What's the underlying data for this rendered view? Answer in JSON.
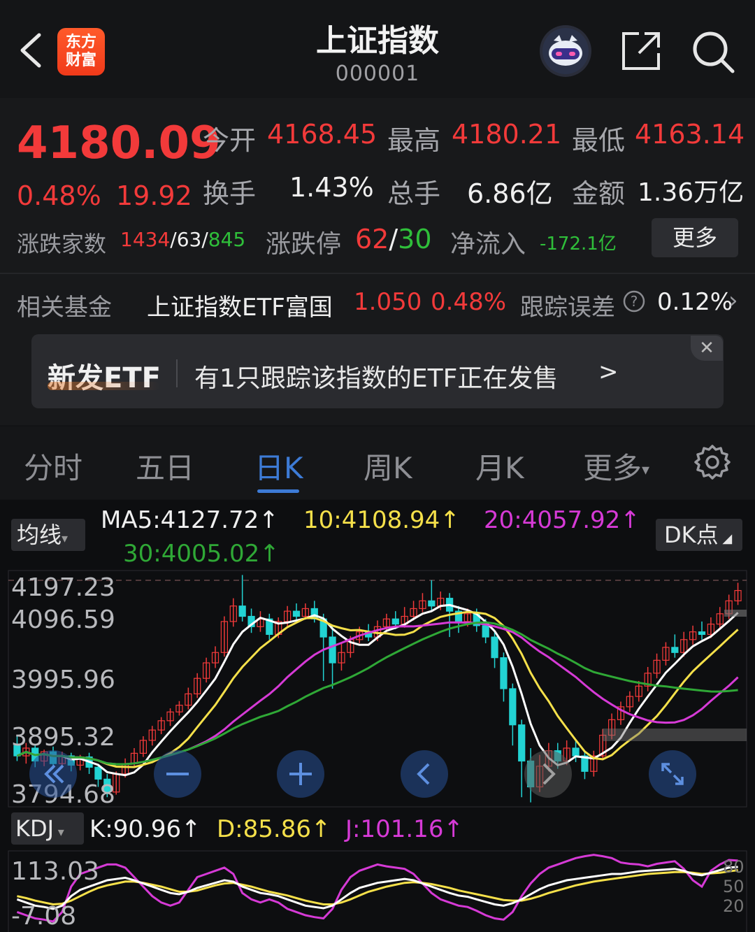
{
  "header": {
    "back_icon": "chevron-left-icon",
    "logo_line1": "东方",
    "logo_line2": "财富",
    "title": "上证指数",
    "code": "000001",
    "robot_icon": "robot-assistant-icon",
    "share_icon": "share-icon",
    "search_icon": "search-icon"
  },
  "quote": {
    "price": "4180.09",
    "change_pct": "0.48%",
    "change_val": "19.92",
    "open_label": "今开",
    "open": "4168.45",
    "high_label": "最高",
    "high": "4180.21",
    "low_label": "最低",
    "low": "4163.14",
    "turnover_label": "换手",
    "turnover": "1.43%",
    "volume_label": "总手",
    "volume": "6.86亿",
    "amount_label": "金额",
    "amount": "1.36万亿",
    "updown_label": "涨跌家数",
    "up_count": "1434",
    "sep1": "/",
    "flat_count": "63",
    "sep2": "/",
    "down_count": "845",
    "limit_label": "涨跌停",
    "limit_up": "62",
    "limit_sep": "/",
    "limit_down": "30",
    "inflow_label": "净流入",
    "inflow": "-172.1亿",
    "more_button": "更多"
  },
  "fund": {
    "label": "相关基金",
    "name": "上证指数ETF富国",
    "price": "1.050",
    "pct": "0.48%",
    "track_label": "跟踪误差",
    "help_icon": "question-circle-icon",
    "track_value": "0.12%",
    "chevron": "›"
  },
  "banner": {
    "tag": "新发ETF",
    "text": "有1只跟踪该指数的ETF正在发售",
    "arrow": ">",
    "close": "✕"
  },
  "tabs": [
    "分时",
    "五日",
    "日K",
    "周K",
    "月K",
    "更多"
  ],
  "active_tab": "日K",
  "settings_icon": "gear-icon",
  "ma": {
    "select": "均线",
    "ma5": "MA5:4127.72",
    "ma10": "10:4108.94",
    "ma20": "20:4057.92",
    "ma30": "30:4005.02",
    "arrow": "↑",
    "dk_button": "DK点",
    "colors": {
      "ma5": "#ffffff",
      "ma10": "#f5e04a",
      "ma20": "#d63ad6",
      "ma30": "#2fa836"
    }
  },
  "price_axis": [
    "4197.23",
    "4096.59",
    "3995.96",
    "3895.32",
    "3794.68"
  ],
  "kdj": {
    "select": "KDJ",
    "k": "K:90.96",
    "d": "D:85.86",
    "j": "J:101.16",
    "arrow": "↑",
    "axis_top": "113.03",
    "axis_bottom": "-7.08",
    "ref_80": "80",
    "ref_50": "50",
    "ref_20": "20"
  },
  "controls": [
    "rewind-icon",
    "zoom-out-icon",
    "zoom-in-icon",
    "prev-icon",
    "next-icon",
    "fullscreen-icon"
  ],
  "chart_data": {
    "type": "candlestick",
    "y_range": [
      3760,
      4220
    ],
    "candles": [
      [
        3880,
        3860,
        3900,
        3850
      ],
      [
        3860,
        3875,
        3885,
        3845
      ],
      [
        3875,
        3850,
        3880,
        3838
      ],
      [
        3850,
        3868,
        3872,
        3840
      ],
      [
        3868,
        3845,
        3878,
        3835
      ],
      [
        3845,
        3860,
        3868,
        3836
      ],
      [
        3860,
        3842,
        3866,
        3830
      ],
      [
        3842,
        3858,
        3862,
        3832
      ],
      [
        3858,
        3838,
        3866,
        3825
      ],
      [
        3838,
        3815,
        3842,
        3800
      ],
      [
        3815,
        3790,
        3825,
        3780
      ],
      [
        3790,
        3825,
        3830,
        3785
      ],
      [
        3825,
        3845,
        3855,
        3818
      ],
      [
        3845,
        3865,
        3875,
        3838
      ],
      [
        3865,
        3890,
        3898,
        3858
      ],
      [
        3890,
        3910,
        3918,
        3880
      ],
      [
        3910,
        3928,
        3935,
        3902
      ],
      [
        3928,
        3945,
        3952,
        3918
      ],
      [
        3945,
        3958,
        3966,
        3938
      ],
      [
        3958,
        3980,
        3992,
        3950
      ],
      [
        3980,
        4010,
        4020,
        3972
      ],
      [
        4010,
        4040,
        4050,
        4002
      ],
      [
        4040,
        4060,
        4072,
        4030
      ],
      [
        4060,
        4120,
        4130,
        4052
      ],
      [
        4120,
        4150,
        4165,
        4110
      ],
      [
        4150,
        4130,
        4210,
        4120
      ],
      [
        4130,
        4110,
        4145,
        4098
      ],
      [
        4110,
        4125,
        4140,
        4100
      ],
      [
        4125,
        4095,
        4135,
        4085
      ],
      [
        4095,
        4120,
        4128,
        4088
      ],
      [
        4120,
        4140,
        4150,
        4110
      ],
      [
        4140,
        4130,
        4155,
        4122
      ],
      [
        4130,
        4145,
        4155,
        4124
      ],
      [
        4145,
        4125,
        4160,
        4118
      ],
      [
        4125,
        4090,
        4135,
        4005
      ],
      [
        4090,
        4040,
        4110,
        3990
      ],
      [
        4040,
        4060,
        4080,
        4025
      ],
      [
        4060,
        4085,
        4092,
        4050
      ],
      [
        4085,
        4100,
        4110,
        4078
      ],
      [
        4100,
        4090,
        4115,
        4082
      ],
      [
        4090,
        4110,
        4122,
        4082
      ],
      [
        4110,
        4125,
        4135,
        4100
      ],
      [
        4125,
        4115,
        4140,
        4105
      ],
      [
        4115,
        4130,
        4148,
        4108
      ],
      [
        4130,
        4145,
        4160,
        4122
      ],
      [
        4145,
        4160,
        4175,
        4138
      ],
      [
        4160,
        4150,
        4200,
        4140
      ],
      [
        4150,
        4165,
        4178,
        4142
      ],
      [
        4165,
        4140,
        4175,
        4090
      ],
      [
        4140,
        4120,
        4150,
        4098
      ],
      [
        4120,
        4135,
        4145,
        4110
      ],
      [
        4135,
        4112,
        4145,
        4100
      ],
      [
        4112,
        4090,
        4125,
        4078
      ],
      [
        4090,
        4050,
        4100,
        4030
      ],
      [
        4050,
        3990,
        4060,
        3965
      ],
      [
        3990,
        3920,
        4000,
        3880
      ],
      [
        3920,
        3850,
        3930,
        3780
      ],
      [
        3850,
        3800,
        3875,
        3770
      ],
      [
        3800,
        3840,
        3862,
        3790
      ],
      [
        3840,
        3870,
        3885,
        3830
      ],
      [
        3870,
        3850,
        3885,
        3835
      ],
      [
        3850,
        3875,
        3890,
        3842
      ],
      [
        3875,
        3860,
        3890,
        3848
      ],
      [
        3860,
        3830,
        3870,
        3815
      ],
      [
        3830,
        3860,
        3870,
        3820
      ],
      [
        3860,
        3900,
        3912,
        3852
      ],
      [
        3900,
        3930,
        3942,
        3892
      ],
      [
        3930,
        3955,
        3965,
        3920
      ],
      [
        3955,
        3975,
        3985,
        3945
      ],
      [
        3975,
        3995,
        4005,
        3965
      ],
      [
        3995,
        4020,
        4032,
        3985
      ],
      [
        4020,
        4045,
        4058,
        4010
      ],
      [
        4045,
        4070,
        4080,
        4035
      ],
      [
        4070,
        4060,
        4095,
        4050
      ],
      [
        4060,
        4085,
        4100,
        4052
      ],
      [
        4085,
        4100,
        4112,
        4075
      ],
      [
        4100,
        4095,
        4120,
        4085
      ],
      [
        4095,
        4115,
        4128,
        4088
      ],
      [
        4115,
        4135,
        4148,
        4105
      ],
      [
        4135,
        4160,
        4172,
        4125
      ],
      [
        4160,
        4180,
        4195,
        4152
      ]
    ],
    "kdj_range": [
      -7.08,
      113.03
    ],
    "k": [
      40,
      35,
      30,
      28,
      25,
      30,
      45,
      55,
      60,
      65,
      70,
      72,
      74,
      70,
      65,
      60,
      55,
      50,
      48,
      52,
      58,
      62,
      66,
      70,
      68,
      60,
      55,
      50,
      48,
      45,
      40,
      35,
      30,
      28,
      26,
      30,
      40,
      50,
      58,
      62,
      66,
      68,
      70,
      72,
      70,
      65,
      60,
      55,
      50,
      46,
      44,
      40,
      36,
      32,
      30,
      34,
      40,
      48,
      56,
      62,
      66,
      70,
      72,
      74,
      76,
      78,
      80,
      80,
      82,
      84,
      85,
      86,
      87,
      88,
      85,
      80,
      78,
      82,
      86,
      90,
      91
    ],
    "d": [
      45,
      42,
      38,
      35,
      32,
      33,
      38,
      45,
      52,
      58,
      62,
      65,
      68,
      68,
      66,
      63,
      60,
      56,
      52,
      52,
      54,
      58,
      62,
      65,
      66,
      63,
      60,
      56,
      52,
      49,
      46,
      42,
      38,
      35,
      32,
      32,
      35,
      40,
      46,
      52,
      56,
      60,
      63,
      66,
      67,
      66,
      64,
      61,
      58,
      54,
      51,
      48,
      45,
      42,
      39,
      38,
      38,
      41,
      45,
      50,
      54,
      58,
      62,
      65,
      68,
      70,
      72,
      74,
      76,
      78,
      80,
      81,
      82,
      83,
      83,
      82,
      80,
      81,
      82,
      84,
      86
    ],
    "j": [
      20,
      15,
      10,
      8,
      5,
      20,
      60,
      80,
      85,
      90,
      95,
      95,
      90,
      75,
      60,
      45,
      35,
      30,
      35,
      55,
      75,
      80,
      85,
      90,
      80,
      50,
      40,
      35,
      40,
      35,
      25,
      20,
      15,
      12,
      10,
      25,
      55,
      75,
      85,
      90,
      95,
      92,
      90,
      88,
      80,
      65,
      50,
      40,
      35,
      30,
      28,
      22,
      15,
      10,
      8,
      20,
      45,
      65,
      80,
      90,
      95,
      100,
      105,
      108,
      110,
      108,
      105,
      98,
      96,
      95,
      92,
      96,
      98,
      100,
      88,
      70,
      60,
      85,
      95,
      102,
      101
    ]
  }
}
